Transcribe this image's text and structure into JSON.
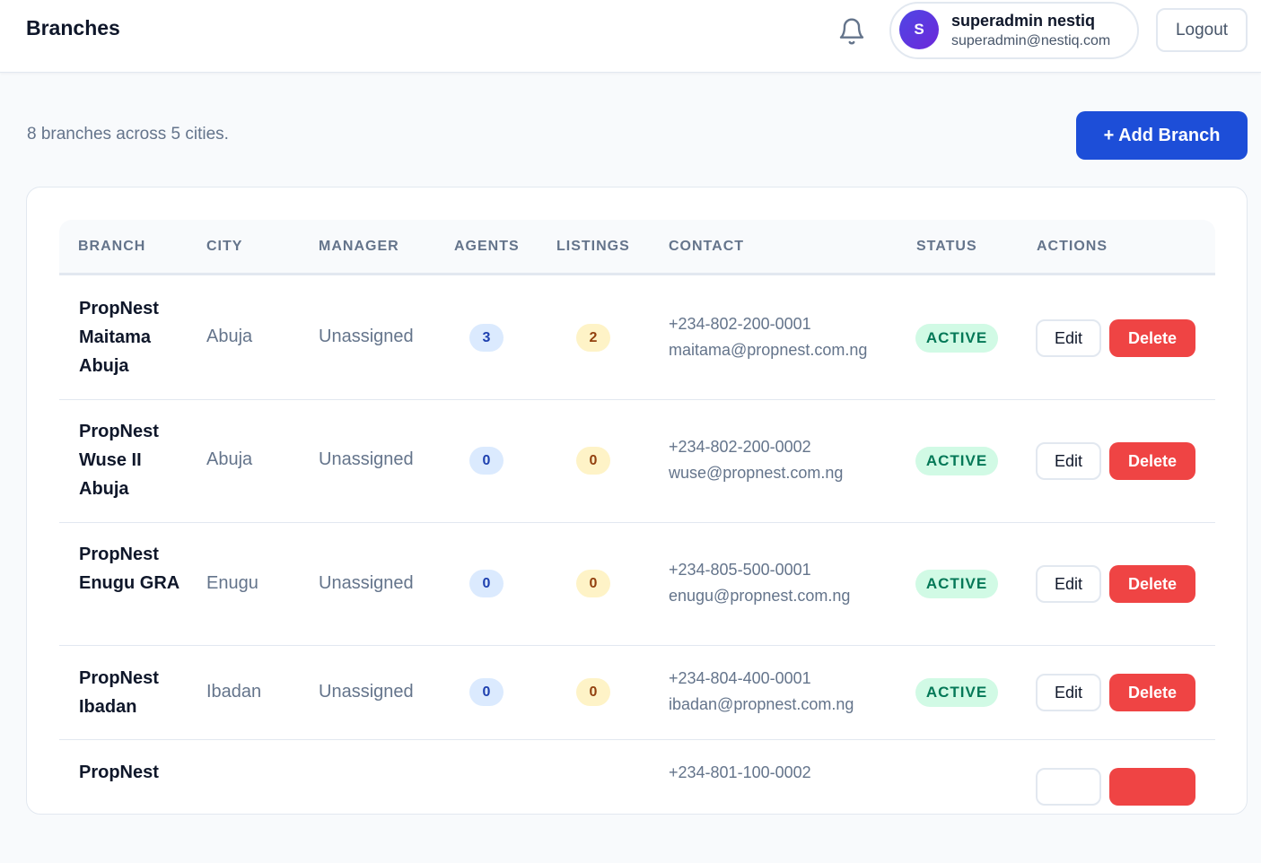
{
  "header": {
    "title": "Branches",
    "notifications_icon": "bell-icon",
    "user": {
      "initial": "S",
      "name": "superadmin nestiq",
      "email": "superadmin@nestiq.com"
    },
    "logout_label": "Logout"
  },
  "summary": {
    "text": "8 branches across 5 cities.",
    "add_button_label": "+ Add Branch"
  },
  "table": {
    "columns": [
      "BRANCH",
      "CITY",
      "MANAGER",
      "AGENTS",
      "LISTINGS",
      "CONTACT",
      "STATUS",
      "ACTIONS"
    ],
    "rows": [
      {
        "name": "PropNest Maitama Abuja",
        "city": "Abuja",
        "manager": "Unassigned",
        "agents": "3",
        "listings": "2",
        "phone": "+234-802-200-0001",
        "email": "maitama@propnest.com.ng",
        "status": "ACTIVE",
        "edit_label": "Edit",
        "delete_label": "Delete"
      },
      {
        "name": "PropNest Wuse II Abuja",
        "city": "Abuja",
        "manager": "Unassigned",
        "agents": "0",
        "listings": "0",
        "phone": "+234-802-200-0002",
        "email": "wuse@propnest.com.ng",
        "status": "ACTIVE",
        "edit_label": "Edit",
        "delete_label": "Delete"
      },
      {
        "name": "PropNest Enugu GRA",
        "city": "Enugu",
        "manager": "Unassigned",
        "agents": "0",
        "listings": "0",
        "phone": "+234-805-500-0001",
        "email": "enugu@propnest.com.ng",
        "status": "ACTIVE",
        "edit_label": "Edit",
        "delete_label": "Delete"
      },
      {
        "name": "PropNest Ibadan",
        "city": "Ibadan",
        "manager": "Unassigned",
        "agents": "0",
        "listings": "0",
        "phone": "+234-804-400-0001",
        "email": "ibadan@propnest.com.ng",
        "status": "ACTIVE",
        "edit_label": "Edit",
        "delete_label": "Delete"
      },
      {
        "name": "PropNest",
        "phone": "+234-801-100-0002"
      }
    ]
  }
}
